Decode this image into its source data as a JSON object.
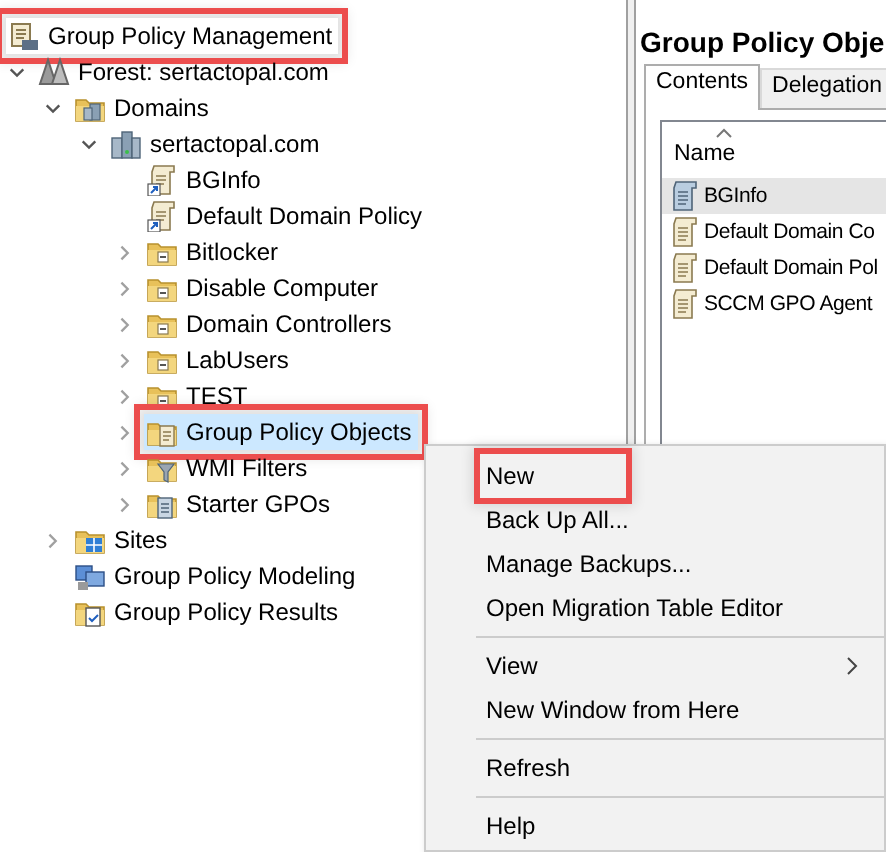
{
  "tree": [
    {
      "label": "Group Policy Management",
      "kind": "console",
      "selected": false,
      "annotated": true,
      "children": [
        {
          "label": "Forest: sertactopal.com",
          "kind": "forest",
          "selected": false,
          "annotated": false,
          "expanded": true,
          "children": [
            {
              "label": "Domains",
              "kind": "domains",
              "selected": false,
              "annotated": false,
              "expanded": true,
              "children": [
                {
                  "label": "sertactopal.com",
                  "kind": "domain",
                  "selected": false,
                  "annotated": false,
                  "expanded": true,
                  "children": [
                    {
                      "label": "BGInfo",
                      "kind": "gpo-link",
                      "selected": false,
                      "annotated": false
                    },
                    {
                      "label": "Default Domain Policy",
                      "kind": "gpo-link",
                      "selected": false,
                      "annotated": false
                    },
                    {
                      "label": "Bitlocker",
                      "kind": "ou",
                      "selected": false,
                      "annotated": false,
                      "expanded": false
                    },
                    {
                      "label": "Disable Computer",
                      "kind": "ou",
                      "selected": false,
                      "annotated": false,
                      "expanded": false
                    },
                    {
                      "label": "Domain Controllers",
                      "kind": "ou",
                      "selected": false,
                      "annotated": false,
                      "expanded": false
                    },
                    {
                      "label": "LabUsers",
                      "kind": "ou",
                      "selected": false,
                      "annotated": false,
                      "expanded": false
                    },
                    {
                      "label": "TEST",
                      "kind": "ou",
                      "selected": false,
                      "annotated": false,
                      "expanded": false
                    },
                    {
                      "label": "Group Policy Objects",
                      "kind": "gpo-folder",
                      "selected": true,
                      "annotated": true,
                      "expanded": false
                    },
                    {
                      "label": "WMI Filters",
                      "kind": "wmi",
                      "selected": false,
                      "annotated": false,
                      "expanded": false
                    },
                    {
                      "label": "Starter GPOs",
                      "kind": "starter",
                      "selected": false,
                      "annotated": false,
                      "expanded": false
                    }
                  ]
                }
              ]
            },
            {
              "label": "Sites",
              "kind": "sites",
              "selected": false,
              "annotated": false,
              "expanded": false
            },
            {
              "label": "Group Policy Modeling",
              "kind": "modeling",
              "selected": false,
              "annotated": false
            },
            {
              "label": "Group Policy Results",
              "kind": "results",
              "selected": false,
              "annotated": false
            }
          ]
        }
      ]
    }
  ],
  "details": {
    "title": "Group Policy Obje",
    "tabs": [
      {
        "label": "Contents",
        "selected": true
      },
      {
        "label": "Delegation",
        "selected": false
      }
    ],
    "columns": [
      "Name"
    ],
    "rows": [
      {
        "name": "BGInfo",
        "selected": true
      },
      {
        "name": "Default Domain Co",
        "selected": false
      },
      {
        "name": "Default Domain Pol",
        "selected": false
      },
      {
        "name": "SCCM GPO Agent",
        "selected": false
      }
    ]
  },
  "context_menu": [
    {
      "kind": "command",
      "label": "New",
      "submenu": false,
      "annotated": true
    },
    {
      "kind": "command",
      "label": "Back Up All...",
      "submenu": false,
      "annotated": false
    },
    {
      "kind": "command",
      "label": "Manage Backups...",
      "submenu": false,
      "annotated": false
    },
    {
      "kind": "command",
      "label": "Open Migration Table Editor",
      "submenu": false,
      "annotated": false
    },
    {
      "kind": "separator"
    },
    {
      "kind": "command",
      "label": "View",
      "submenu": true,
      "annotated": false
    },
    {
      "kind": "command",
      "label": "New Window from Here",
      "submenu": false,
      "annotated": false
    },
    {
      "kind": "separator"
    },
    {
      "kind": "command",
      "label": "Refresh",
      "submenu": false,
      "annotated": false
    },
    {
      "kind": "separator"
    },
    {
      "kind": "command",
      "label": "Help",
      "submenu": false,
      "annotated": false
    }
  ]
}
